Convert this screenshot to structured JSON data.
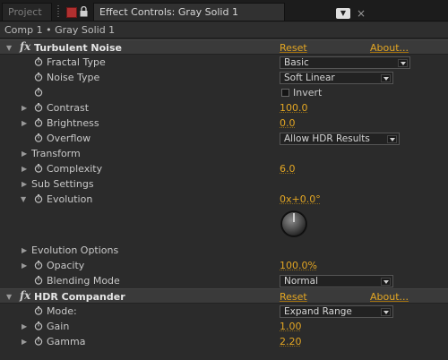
{
  "tabs": {
    "project": "Project",
    "effect_controls": "Effect Controls: Gray Solid 1"
  },
  "breadcrumb": "Comp 1 • Gray Solid 1",
  "effects": [
    {
      "name": "Turbulent Noise",
      "reset": "Reset",
      "about": "About...",
      "fractal_type": {
        "label": "Fractal Type",
        "value": "Basic"
      },
      "noise_type": {
        "label": "Noise Type",
        "value": "Soft Linear"
      },
      "invert": {
        "label": "Invert",
        "checked": false
      },
      "contrast": {
        "label": "Contrast",
        "value": "100.0"
      },
      "brightness": {
        "label": "Brightness",
        "value": "0.0"
      },
      "overflow": {
        "label": "Overflow",
        "value": "Allow HDR Results"
      },
      "transform": {
        "label": "Transform"
      },
      "complexity": {
        "label": "Complexity",
        "value": "6.0"
      },
      "sub_settings": {
        "label": "Sub Settings"
      },
      "evolution": {
        "label": "Evolution",
        "value": "0x+0.0°"
      },
      "evolution_options": {
        "label": "Evolution Options"
      },
      "opacity": {
        "label": "Opacity",
        "value": "100.0%"
      },
      "blending_mode": {
        "label": "Blending Mode",
        "value": "Normal"
      }
    },
    {
      "name": "HDR Compander",
      "reset": "Reset",
      "about": "About...",
      "mode": {
        "label": "Mode:",
        "value": "Expand Range"
      },
      "gain": {
        "label": "Gain",
        "value": "1.00"
      },
      "gamma": {
        "label": "Gamma",
        "value": "2.20"
      }
    }
  ],
  "colors": {
    "accent_value": "#e3a623",
    "panel_bg": "#2b2b2b",
    "lock_red": "#b03030"
  },
  "icons": {
    "stopwatch": "stopwatch-icon",
    "fx": "fx-icon",
    "expand": "triangle-icon"
  }
}
